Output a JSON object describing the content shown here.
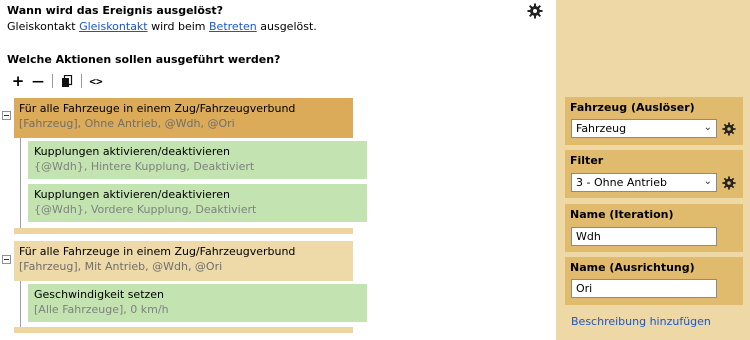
{
  "trigger": {
    "title": "Wann wird das Ereignis ausgelöst?",
    "sentence_part1": "Gleiskontakt ",
    "contact_link": "Gleiskontakt",
    "sentence_part2": " wird beim ",
    "event_link": "Betreten",
    "sentence_part3": " ausgelöst."
  },
  "actions": {
    "title": "Welche Aktionen sollen ausgeführt werden?",
    "toolbar": {
      "add": "+",
      "remove": "—",
      "code": "<>"
    },
    "groups": [
      {
        "title": "Für alle Fahrzeuge in einem Zug/Fahrzeugverbund",
        "subtitle": "[Fahrzeug], Ohne Antrieb, @Wdh, @Ori",
        "children": [
          {
            "title": "Kupplungen aktivieren/deaktivieren",
            "subtitle": "{@Wdh}, Hintere Kupplung, Deaktiviert"
          },
          {
            "title": "Kupplungen aktivieren/deaktivieren",
            "subtitle": "{@Wdh}, Vordere Kupplung, Deaktiviert"
          }
        ]
      },
      {
        "title": "Für alle Fahrzeuge in einem Zug/Fahrzeugverbund",
        "subtitle": "[Fahrzeug], Mit Antrieb, @Wdh, @Ori",
        "children": [
          {
            "title": "Geschwindigkeit setzen",
            "subtitle": "[Alle Fahrzeuge], 0 km/h"
          }
        ]
      }
    ]
  },
  "properties": {
    "vehicle_label": "Fahrzeug (Auslöser)",
    "vehicle_value": "Fahrzeug",
    "filter_label": "Filter",
    "filter_value": "3 - Ohne Antrieb",
    "iteration_label": "Name (Iteration)",
    "iteration_value": "Wdh",
    "orientation_label": "Name (Ausrichtung)",
    "orientation_value": "Ori",
    "add_description": "Beschreibung hinzufügen"
  },
  "colors": {
    "group_active": "#dbab5a",
    "group_inactive": "#eedaa8",
    "child": "#c3e4b1",
    "panel": "#eed9a6",
    "panel_box": "#e0bb6e",
    "link": "#1a56c9"
  }
}
